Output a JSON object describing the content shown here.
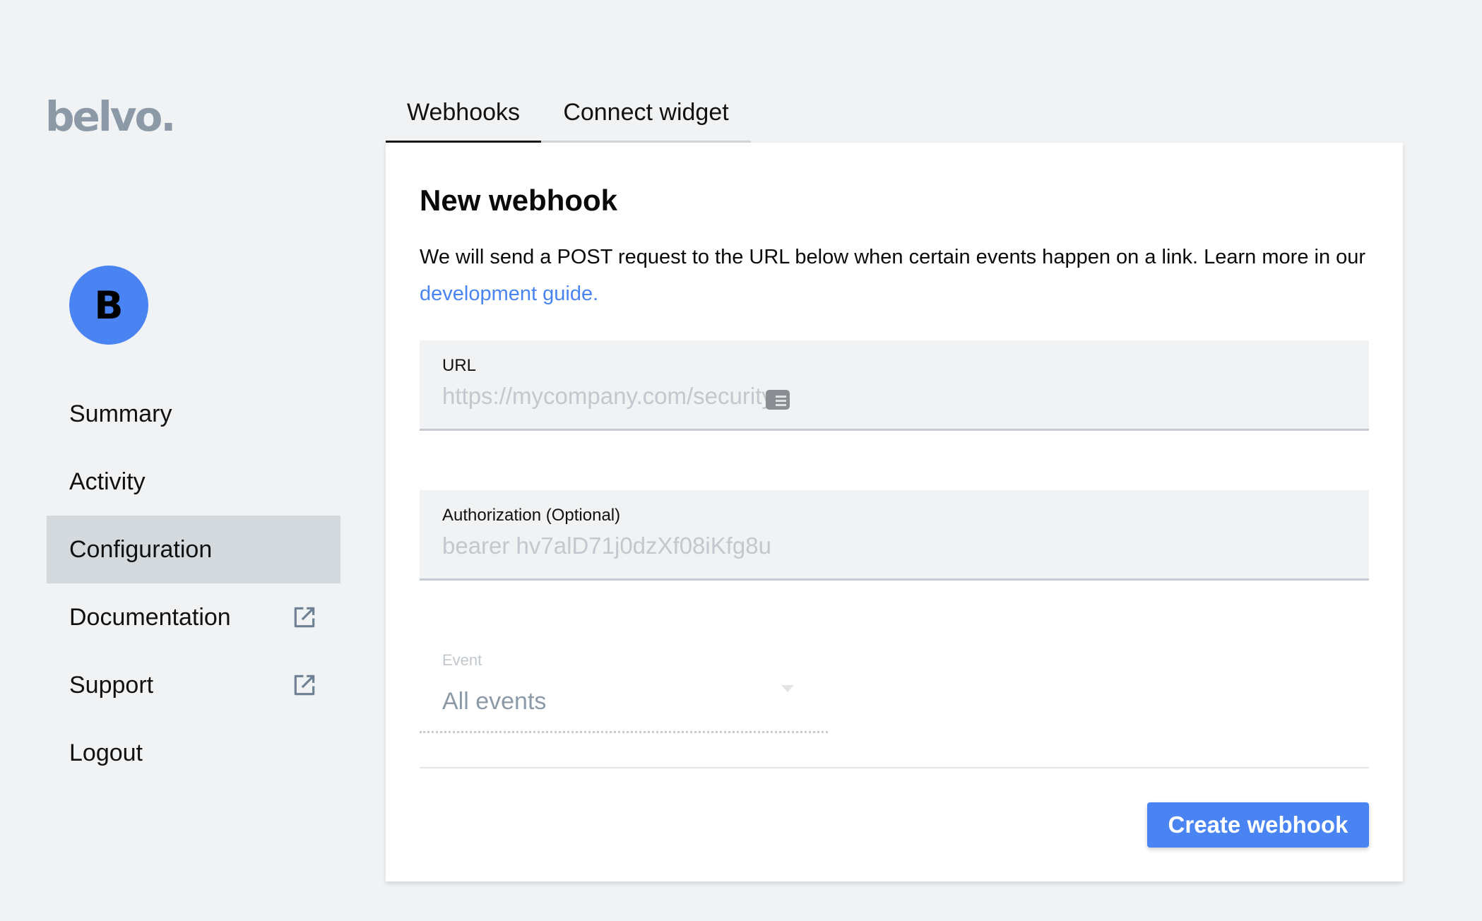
{
  "brand": {
    "logo_text": "belvo.",
    "accent_color": "#4a84f2"
  },
  "user": {
    "avatar_initial": "B"
  },
  "sidebar": {
    "items": [
      {
        "label": "Summary",
        "active": false,
        "external": false
      },
      {
        "label": "Activity",
        "active": false,
        "external": false
      },
      {
        "label": "Configuration",
        "active": true,
        "external": false
      },
      {
        "label": "Documentation",
        "active": false,
        "external": true,
        "icon": "external-link-icon"
      },
      {
        "label": "Support",
        "active": false,
        "external": true,
        "icon": "external-link-icon"
      },
      {
        "label": "Logout",
        "active": false,
        "external": false
      }
    ]
  },
  "tabs": [
    {
      "label": "Webhooks",
      "active": true
    },
    {
      "label": "Connect widget",
      "active": false
    }
  ],
  "card": {
    "title": "New webhook",
    "description": "We will send a POST request to the URL below when certain events happen on a link. Learn more in our ",
    "link_text": "development guide.",
    "url_field": {
      "label": "URL",
      "placeholder": "https://mycompany.com/security",
      "value": ""
    },
    "auth_field": {
      "label": "Authorization (Optional)",
      "placeholder": "bearer hv7alD71j0dzXf08iKfg8u",
      "value": ""
    },
    "event_select": {
      "label": "Event",
      "selected": "All events"
    },
    "submit_label": "Create webhook"
  }
}
